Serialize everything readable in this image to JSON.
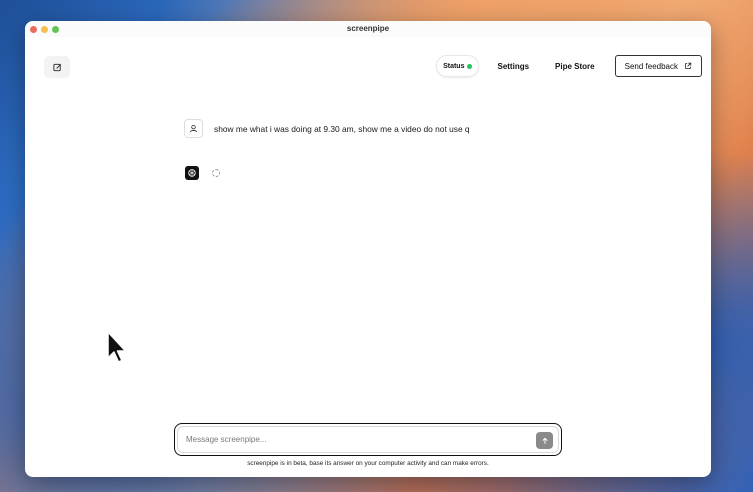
{
  "app": {
    "title": "screenpipe"
  },
  "nav": {
    "status_label": "Status",
    "status_color": "#22c55e",
    "settings_label": "Settings",
    "pipe_store_label": "Pipe Store",
    "feedback_label": "Send feedback"
  },
  "chat": {
    "messages": [
      {
        "role": "user",
        "text": "show me what i was doing at 9.30 am, show me a video do not use q",
        "icon": "user-icon"
      },
      {
        "role": "assistant",
        "state": "loading",
        "icon": "openai-icon"
      }
    ]
  },
  "composer": {
    "placeholder": "Message screenpipe...",
    "value": "",
    "send_icon": "arrow-up-icon",
    "disclaimer": "screenpipe is in beta, base its answer on your computer activity and can make errors."
  },
  "toolbar": {
    "new_chat_icon": "new-chat-icon"
  }
}
